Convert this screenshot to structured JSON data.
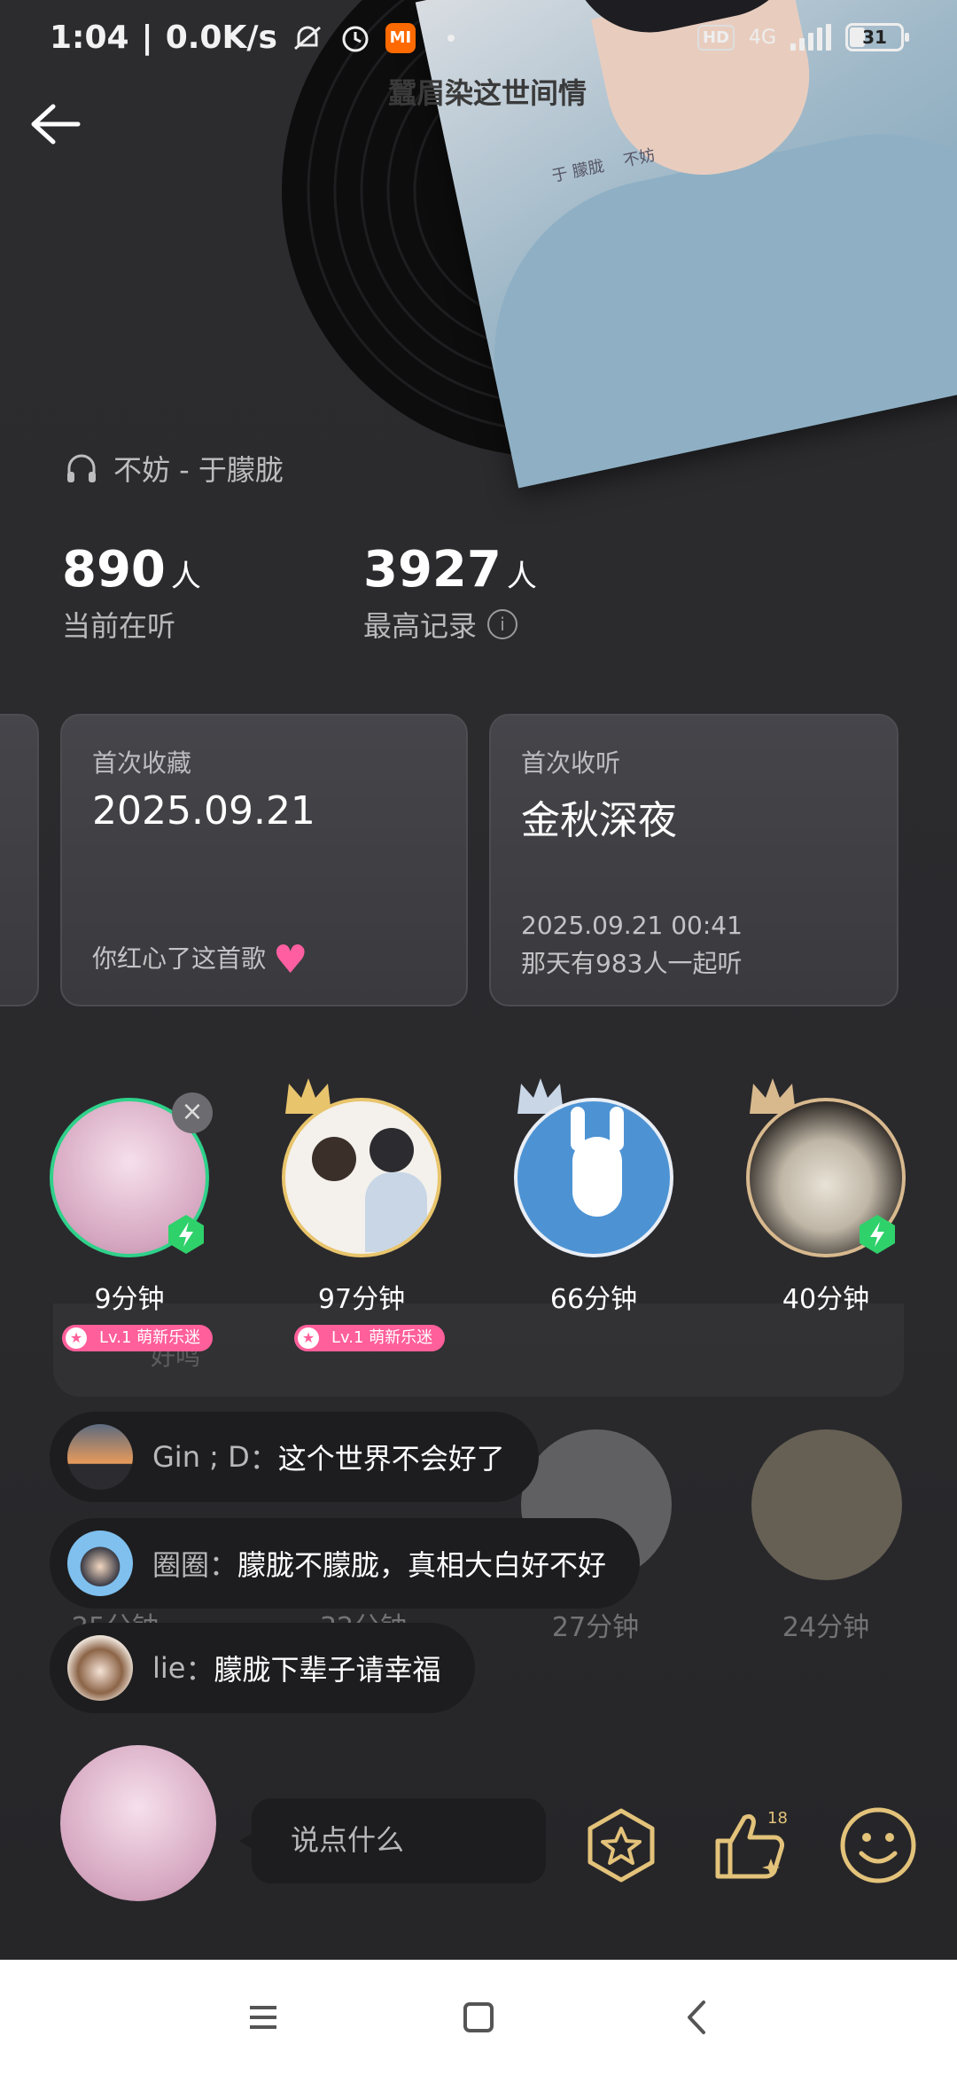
{
  "status_bar": {
    "time": "1:04",
    "net_speed": "0.0K/s",
    "network": "4G",
    "battery": "31",
    "battery_level": 0.31,
    "hd": "HD",
    "mi": "MI"
  },
  "header": {
    "title": "蠶眉染这世间情"
  },
  "song": {
    "text": "不妨 - 于朦胧"
  },
  "stats": {
    "current": {
      "value": "890",
      "unit": "人",
      "label": "当前在听"
    },
    "record": {
      "value": "3927",
      "unit": "人",
      "label": "最高记录"
    }
  },
  "cards": [
    {
      "key": "首次收藏",
      "value": "2025.09.21",
      "note": "你红心了这首歌"
    },
    {
      "key": "首次收听",
      "value": "金秋深夜",
      "note1": "2025.09.21 00:41",
      "note2": "那天有983人一起听"
    }
  ],
  "cover_text": {
    "a": "于 朦胧",
    "b": "不妨"
  },
  "listeners": [
    {
      "time": "9分钟",
      "level": "Lv.1 萌新乐迷"
    },
    {
      "time": "97分钟",
      "level": "Lv.1 萌新乐迷"
    },
    {
      "time": "66分钟"
    },
    {
      "time": "40分钟"
    }
  ],
  "listeners_faded": [
    {
      "time": "25分钟"
    },
    {
      "time": "32分钟"
    },
    {
      "time": "27分钟"
    },
    {
      "time": "24分钟"
    }
  ],
  "faded_label": "好鸣",
  "comments": [
    {
      "user": "Gin ; D",
      "text": "这个世界不会好了"
    },
    {
      "user": "圈圈",
      "text": "朦胧不朦胧，真相大白好不好"
    },
    {
      "user": "lie",
      "text": "朦胧下辈子请幸福"
    }
  ],
  "comment_sep": "：",
  "input": {
    "placeholder": "说点什么"
  },
  "like": {
    "count": "18"
  },
  "colors": {
    "accent_gold": "#e3c27a",
    "bolt_green": "#2fd16b",
    "level_pink": "#ff5f9a"
  }
}
